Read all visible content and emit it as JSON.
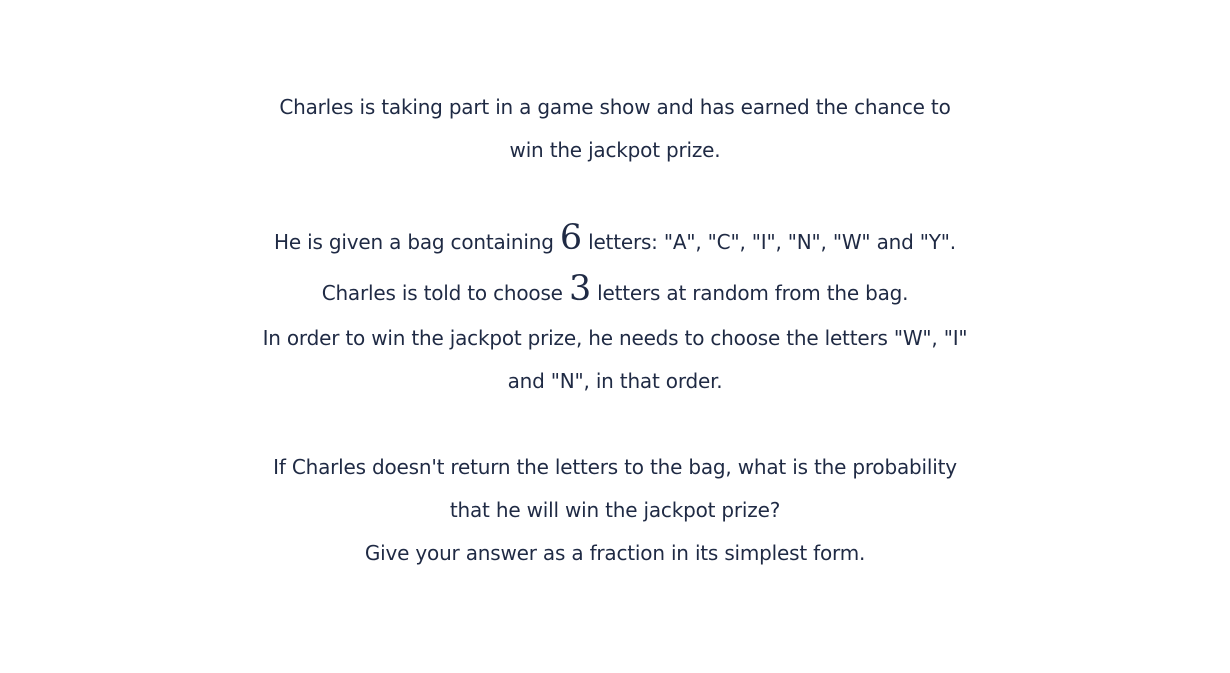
{
  "question": {
    "intro_line1": "Charles is taking part in a game show and has earned the chance to",
    "intro_line2": "win the jackpot prize.",
    "bag_pre": "He is given a bag containing ",
    "bag_num": "6",
    "bag_post": " letters: \"A\", \"C\", \"I\", \"N\", \"W\" and \"Y\".",
    "choose_pre": "Charles is told to choose ",
    "choose_num": "3",
    "choose_post": " letters at random from the bag.",
    "order_line1": "In order to win the jackpot prize, he needs to choose the letters \"W\", \"I\"",
    "order_line2": "and \"N\", in that order.",
    "ask_line1": "If Charles doesn't return the letters to the bag, what is the probability",
    "ask_line2": "that he will win the jackpot prize?",
    "ask_line3": "Give your answer as a fraction in its simplest form."
  }
}
